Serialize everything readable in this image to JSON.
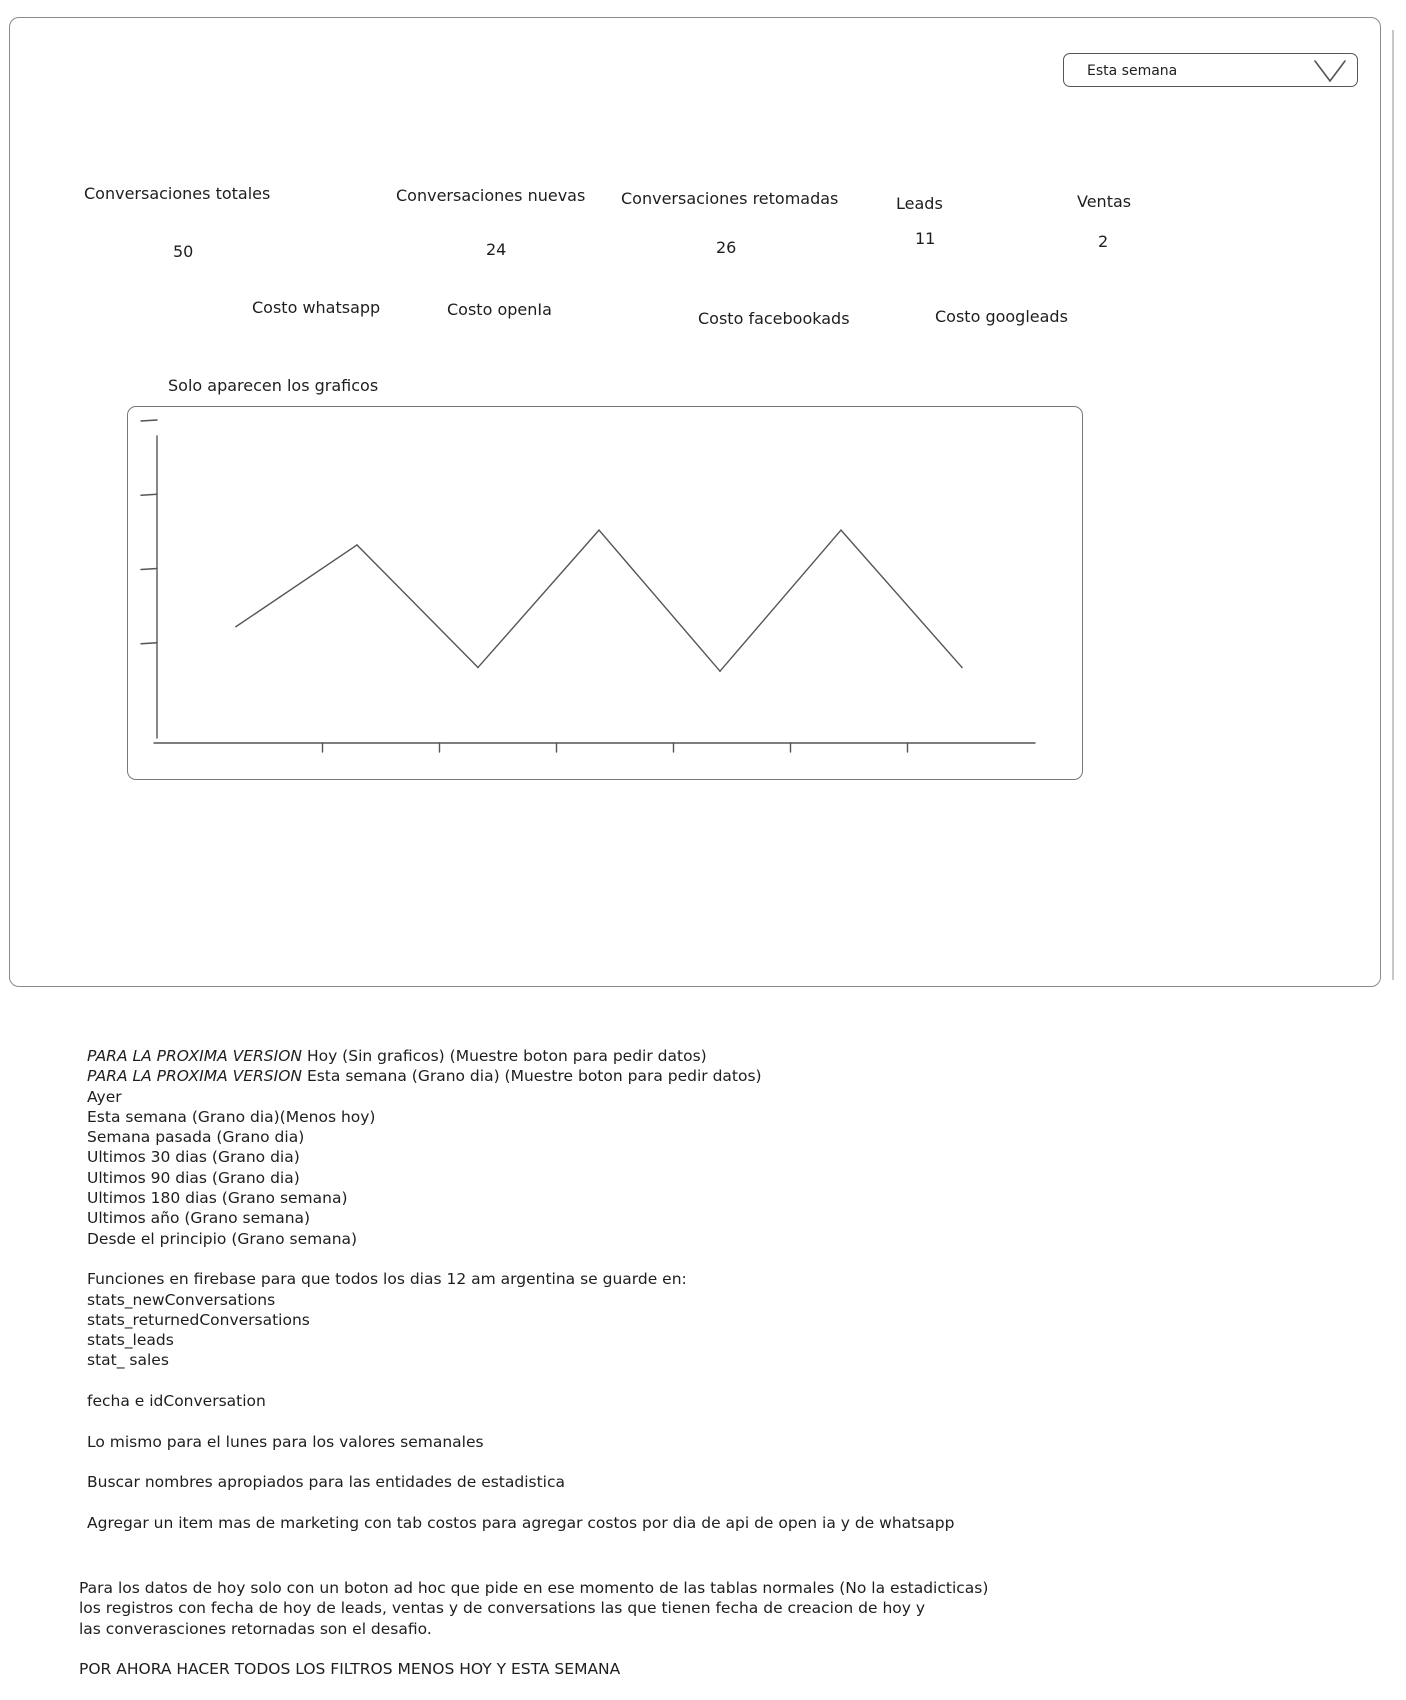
{
  "filter": {
    "selected": "Esta semana"
  },
  "kpis": [
    {
      "label": "Conversaciones totales",
      "value": "50"
    },
    {
      "label": "Conversaciones nuevas",
      "value": "24"
    },
    {
      "label": "Conversaciones retomadas",
      "value": "26"
    },
    {
      "label": "Leads",
      "value": "11"
    },
    {
      "label": "Ventas",
      "value": "2"
    }
  ],
  "costs": [
    {
      "label": "Costo whatsapp"
    },
    {
      "label": "Costo openIa"
    },
    {
      "label": "Costo facebookads"
    },
    {
      "label": "Costo googleads"
    }
  ],
  "chart_caption": "Solo aparecen los graficos",
  "chart_data": {
    "type": "line",
    "title": "",
    "xlabel": "",
    "ylabel": "",
    "x": [
      1,
      2,
      3,
      4,
      5,
      6,
      7,
      8
    ],
    "series": [
      {
        "values": [
          2.5,
          3.6,
          1.95,
          3.8,
          1.9,
          3.8,
          1.95
        ]
      }
    ],
    "xlim": [
      0,
      8
    ],
    "ylim": [
      1,
      5
    ],
    "grid": false
  },
  "notes": {
    "block1": [
      {
        "prefix": "PARA LA PROXIMA VERSION",
        "text": " Hoy (Sin graficos) (Muestre boton para pedir datos)"
      },
      {
        "prefix": "PARA LA PROXIMA VERSION",
        "text": " Esta semana (Grano dia) (Muestre boton para pedir datos)"
      },
      {
        "prefix": "",
        "text": "Ayer"
      },
      {
        "prefix": "",
        "text": "Esta semana (Grano dia)(Menos hoy)"
      },
      {
        "prefix": "",
        "text": "Semana pasada (Grano dia)"
      },
      {
        "prefix": "",
        "text": "Ultimos 30 dias (Grano dia)"
      },
      {
        "prefix": "",
        "text": "Ultimos 90 dias (Grano dia)"
      },
      {
        "prefix": "",
        "text": "Ultimos 180 dias (Grano semana)"
      },
      {
        "prefix": "",
        "text": "Ultimos año (Grano semana)"
      },
      {
        "prefix": "",
        "text": "Desde el principio (Grano semana)"
      },
      {
        "prefix": "",
        "text": ""
      },
      {
        "prefix": "",
        "text": "Funciones en firebase para que todos los dias 12 am argentina se guarde en:"
      },
      {
        "prefix": "",
        "text": "stats_newConversations"
      },
      {
        "prefix": "",
        "text": "stats_returnedConversations"
      },
      {
        "prefix": "",
        "text": "stats_leads"
      },
      {
        "prefix": "",
        "text": "stat_ sales"
      },
      {
        "prefix": "",
        "text": ""
      },
      {
        "prefix": "",
        "text": "fecha e idConversation"
      },
      {
        "prefix": "",
        "text": ""
      },
      {
        "prefix": "",
        "text": "Lo mismo para el lunes para los valores semanales"
      },
      {
        "prefix": "",
        "text": ""
      },
      {
        "prefix": "",
        "text": "Buscar nombres apropiados para las entidades de estadistica"
      },
      {
        "prefix": "",
        "text": ""
      },
      {
        "prefix": "",
        "text": "Agregar un item mas de marketing con tab costos para agregar costos por dia de api de open ia y de whatsapp"
      }
    ],
    "block2": [
      {
        "prefix": "",
        "text": "Para los datos de hoy solo con un boton ad hoc que pide en ese momento de las tablas normales (No la estadicticas)"
      },
      {
        "prefix": "",
        "text": "los registros con fecha de hoy de leads, ventas y de conversations las que tienen fecha de creacion de hoy y"
      },
      {
        "prefix": "",
        "text": "las converasciones retornadas son el desafio."
      },
      {
        "prefix": "",
        "text": ""
      },
      {
        "prefix": "",
        "text": "POR AHORA HACER TODOS LOS FILTROS MENOS HOY Y ESTA SEMANA"
      }
    ]
  }
}
